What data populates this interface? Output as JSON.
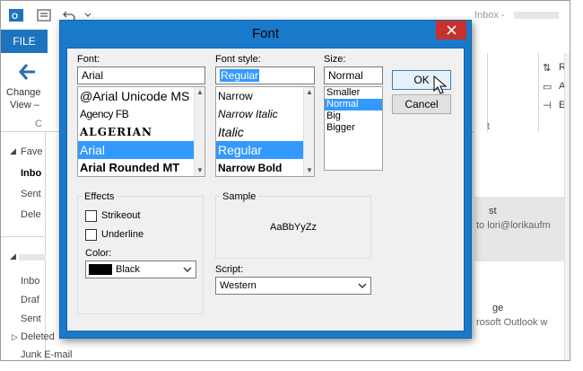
{
  "background": {
    "title_fragment": "Inbox -",
    "file_tab": "FILE",
    "ribbon": {
      "change_view_line1": "Change",
      "change_view_line2": "View –",
      "group_label_c": "C",
      "right_items": [
        "Re",
        "Ad",
        "Exp"
      ],
      "right_letter": "t"
    },
    "nav": {
      "favorites": "Fave",
      "favorites_items": [
        "Inbo",
        "Sent",
        "Dele"
      ],
      "account_items": [
        "Inbo",
        "Draf",
        "Sent",
        "Deleted",
        "Junk E-mail"
      ]
    },
    "message_preview": {
      "line1": "st",
      "line2": "to lori@lorikaufm",
      "line3": "ge",
      "line4": "rosoft Outlook w"
    }
  },
  "dialog": {
    "title": "Font",
    "font": {
      "label": "Font:",
      "value": "Arial",
      "items": [
        "@Arial Unicode MS",
        "Agency FB",
        "ALGERIAN",
        "Arial",
        "Arial Rounded MT"
      ],
      "selected_index": 3
    },
    "font_style": {
      "label": "Font style:",
      "value": "Regular",
      "items": [
        "Narrow",
        "Narrow Italic",
        "Italic",
        "Regular",
        "Narrow Bold"
      ],
      "selected_index": 3
    },
    "size": {
      "label": "Size:",
      "value": "Normal",
      "items": [
        "Smaller",
        "Normal",
        "Big",
        "Bigger"
      ],
      "selected_index": 1
    },
    "buttons": {
      "ok": "OK",
      "cancel": "Cancel"
    },
    "effects": {
      "label": "Effects",
      "strikeout": "Strikeout",
      "underline": "Underline",
      "strikeout_checked": false,
      "underline_checked": false
    },
    "color": {
      "label": "Color:",
      "value": "Black",
      "swatch": "#000000"
    },
    "sample": {
      "label": "Sample",
      "text": "AaBbYyZz"
    },
    "script": {
      "label": "Script:",
      "value": "Western"
    }
  },
  "colors": {
    "title_accent": "#1979ca",
    "close_button": "#c7302b",
    "selection": "#3399ff",
    "file_tab": "#1e73be"
  },
  "icons": {
    "close": "close-icon",
    "scroll_up": "chevron-up-icon",
    "scroll_down": "chevron-down-icon",
    "dropdown": "chevron-down-icon",
    "cursor": "mouse-pointer-icon"
  }
}
